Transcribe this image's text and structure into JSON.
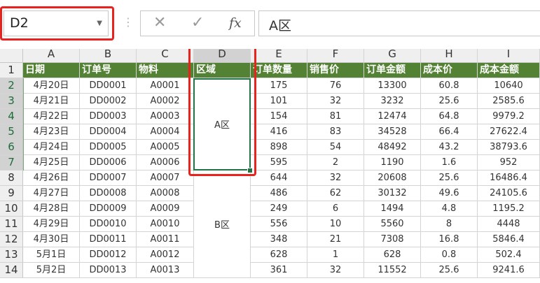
{
  "name_box": {
    "value": "D2"
  },
  "formula_bar": {
    "separator": "⋮",
    "cancel_glyph": "✕",
    "enter_glyph": "✓",
    "fx_label": "fx",
    "value": "A区"
  },
  "columns": [
    "A",
    "B",
    "C",
    "D",
    "E",
    "F",
    "G",
    "H",
    "I"
  ],
  "rows": [
    "1",
    "2",
    "3",
    "4",
    "5",
    "6",
    "7",
    "8",
    "9",
    "10",
    "11",
    "12",
    "13",
    "14"
  ],
  "header_row": [
    "日期",
    "订单号",
    "物料",
    "区域",
    "订单数量",
    "销售价",
    "订单金额",
    "成本价",
    "成本金额"
  ],
  "data_rows": [
    [
      "4月20日",
      "DD0001",
      "A0001",
      "175",
      "76",
      "13300",
      "60.8",
      "10640"
    ],
    [
      "4月21日",
      "DD0002",
      "A0002",
      "101",
      "32",
      "3232",
      "25.6",
      "2585.6"
    ],
    [
      "4月22日",
      "DD0003",
      "A0003",
      "154",
      "81",
      "12474",
      "64.8",
      "9979.2"
    ],
    [
      "4月23日",
      "DD0004",
      "A0004",
      "416",
      "83",
      "34528",
      "66.4",
      "27622.4"
    ],
    [
      "4月24日",
      "DD0005",
      "A0005",
      "898",
      "54",
      "48492",
      "43.2",
      "38793.6"
    ],
    [
      "4月25日",
      "DD0006",
      "A0006",
      "595",
      "2",
      "1190",
      "1.6",
      "952"
    ],
    [
      "4月26日",
      "DD0007",
      "A0007",
      "644",
      "32",
      "20608",
      "25.6",
      "16486.4"
    ],
    [
      "4月27日",
      "DD0008",
      "A0008",
      "486",
      "62",
      "30132",
      "49.6",
      "24105.6"
    ],
    [
      "4月28日",
      "DD0009",
      "A0009",
      "249",
      "6",
      "1494",
      "4.8",
      "1195.2"
    ],
    [
      "4月29日",
      "DD0010",
      "A0010",
      "556",
      "10",
      "5560",
      "8",
      "4448"
    ],
    [
      "4月30日",
      "DD0011",
      "A0011",
      "348",
      "21",
      "7308",
      "16.8",
      "5846.4"
    ],
    [
      "5月1日",
      "DD0012",
      "A0012",
      "628",
      "1",
      "628",
      "0.8",
      "502.4"
    ],
    [
      "5月2日",
      "DD0013",
      "A0013",
      "361",
      "32",
      "11552",
      "25.6",
      "9241.6"
    ]
  ],
  "merged_regions": [
    "A区",
    "B区"
  ],
  "colors": {
    "header_fill": "#548235",
    "selection": "#217346",
    "highlight": "#e8231e"
  }
}
